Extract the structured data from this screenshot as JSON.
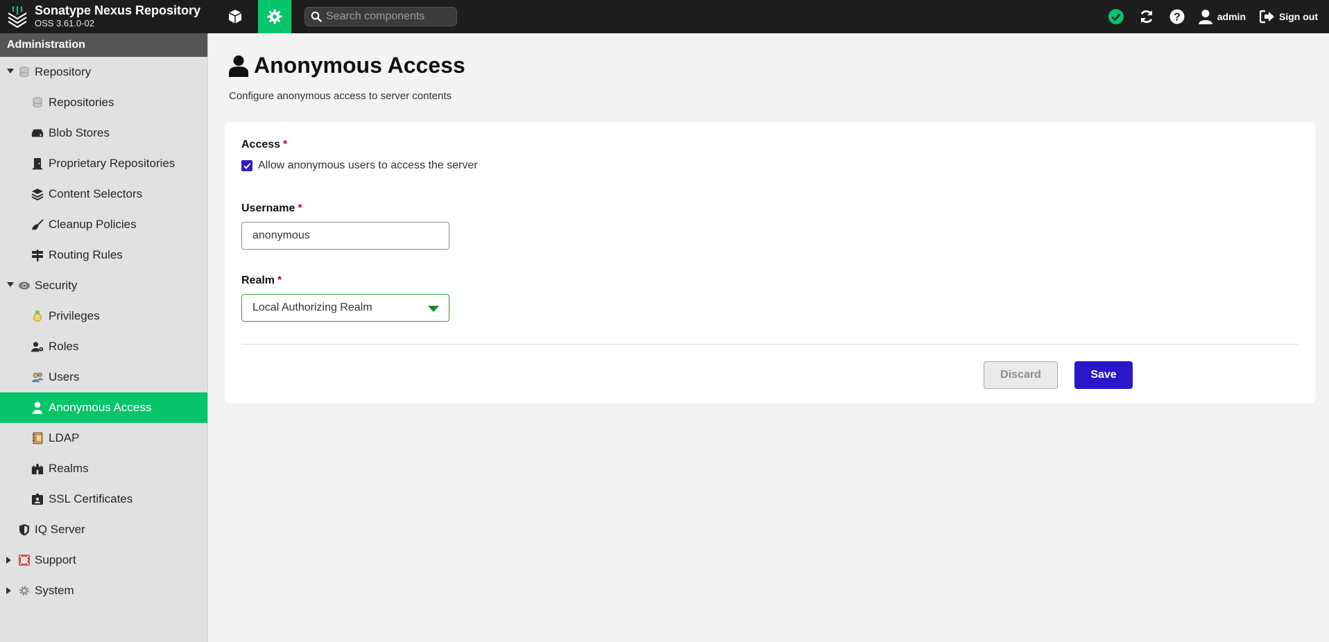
{
  "header": {
    "app_name": "Sonatype Nexus Repository",
    "version": "OSS 3.61.0-02",
    "search_placeholder": "Search components",
    "user_label": "admin",
    "signout_label": "Sign out",
    "accent_color": "#08c46b"
  },
  "sidebar": {
    "title": "Administration",
    "repository": "Repository",
    "repositories": "Repositories",
    "blob_stores": "Blob Stores",
    "proprietary": "Proprietary Repositories",
    "content_selectors": "Content Selectors",
    "cleanup_policies": "Cleanup Policies",
    "routing_rules": "Routing Rules",
    "security": "Security",
    "privileges": "Privileges",
    "roles": "Roles",
    "users": "Users",
    "anonymous_access": "Anonymous Access",
    "ldap": "LDAP",
    "realms": "Realms",
    "ssl_certificates": "SSL Certificates",
    "iq_server": "IQ Server",
    "support": "Support",
    "system": "System"
  },
  "main": {
    "title": "Anonymous Access",
    "subtitle": "Configure anonymous access to server contents",
    "access_label": "Access",
    "required_mark": "*",
    "checkbox_label": "Allow anonymous users to access the server",
    "checkbox_checked": true,
    "username_label": "Username",
    "username_value": "anonymous",
    "realm_label": "Realm",
    "realm_value": "Local Authorizing Realm",
    "discard_label": "Discard",
    "save_label": "Save"
  }
}
